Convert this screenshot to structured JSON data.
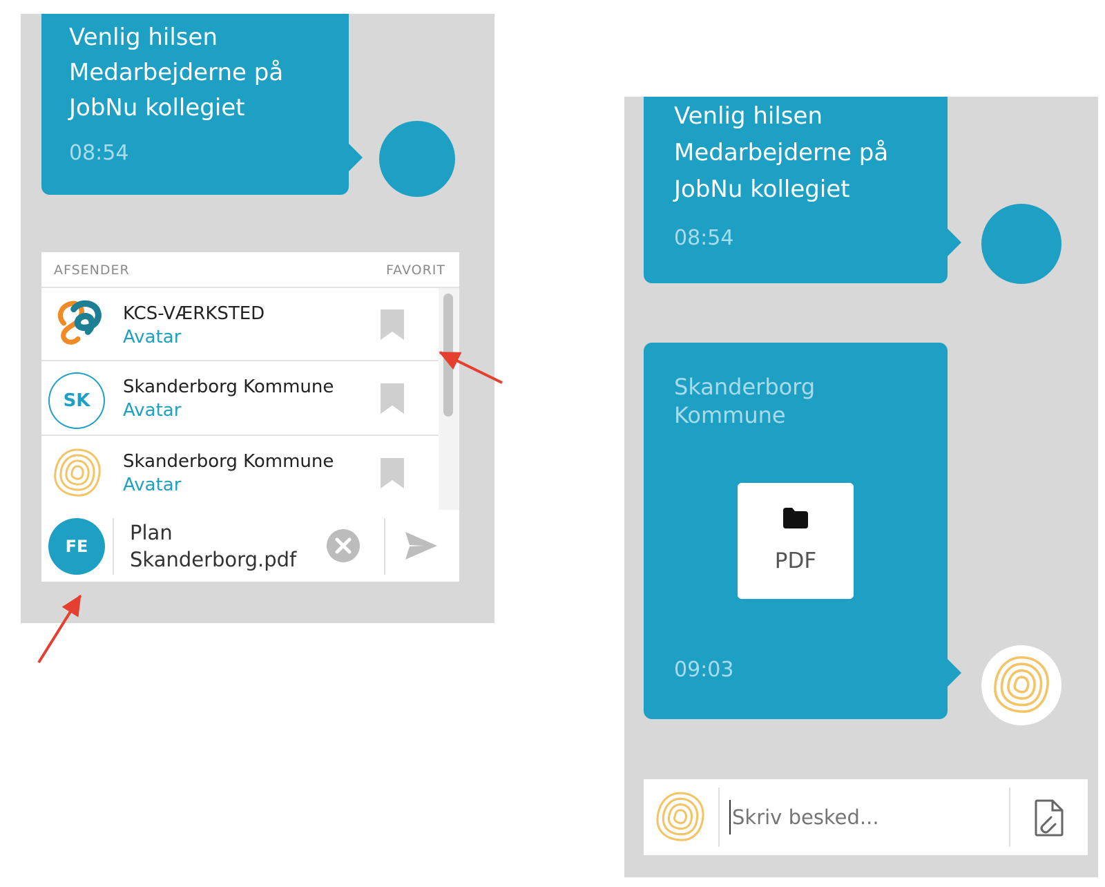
{
  "left": {
    "message": {
      "lines": [
        "Venlig hilsen",
        "Medarbejderne på",
        "JobNu kollegiet"
      ],
      "time": "08:54"
    },
    "picker": {
      "col_sender": "AFSENDER",
      "col_favorite": "FAVORIT",
      "rows": [
        {
          "name": "KCS-VÆRKSTED",
          "sub": "Avatar",
          "avatar": "kcs-logo"
        },
        {
          "name": "Skanderborg Kommune",
          "sub": "Avatar",
          "avatar": "initials",
          "initials": "SK"
        },
        {
          "name": "Skanderborg Kommune",
          "sub": "Avatar",
          "avatar": "contour-logo"
        }
      ]
    },
    "composer": {
      "sender_initials": "FE",
      "attachment_lines": [
        "Plan",
        "Skanderborg.pdf"
      ]
    }
  },
  "right": {
    "message": {
      "lines": [
        "Venlig hilsen",
        "Medarbejderne på",
        "JobNu kollegiet"
      ],
      "time": "08:54"
    },
    "file_message": {
      "sender_lines": [
        "Skanderborg",
        "Kommune"
      ],
      "file_label": "PDF",
      "time": "09:03"
    },
    "composer": {
      "placeholder": "Skriv besked..."
    }
  },
  "colors": {
    "accent": "#1da0c3",
    "panel_bg": "#d8d8d8",
    "arrow": "#e43f2f",
    "logo_orange": "#f3b63a"
  }
}
